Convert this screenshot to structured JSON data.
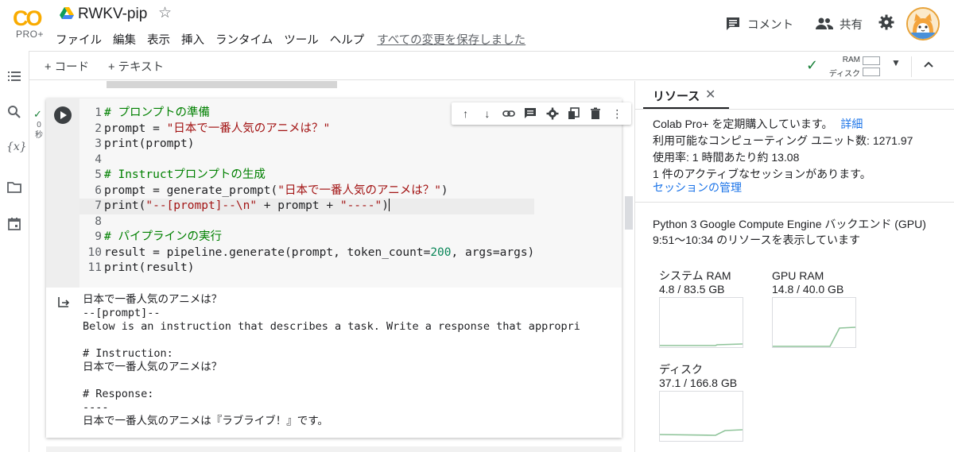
{
  "header": {
    "logo_text": "CO",
    "logo_badge": "PRO+",
    "title": "RWKV-pip",
    "menu": [
      "ファイル",
      "編集",
      "表示",
      "挿入",
      "ランタイム",
      "ツール",
      "ヘルプ"
    ],
    "save_status": "すべての変更を保存しました",
    "comment_label": "コメント",
    "share_label": "共有"
  },
  "toolbar": {
    "add_code": "+ コード",
    "add_text": "+ テキスト",
    "ram_label": "RAM",
    "disk_label": "ディスク"
  },
  "cell": {
    "exec_time_value": "0",
    "exec_time_unit": "秒",
    "lines": [
      {
        "n": "1",
        "parts": [
          {
            "t": "# プロンプトの準備",
            "c": "com"
          }
        ]
      },
      {
        "n": "2",
        "parts": [
          {
            "t": "prompt = ",
            "c": "fn"
          },
          {
            "t": "\"日本で一番人気のアニメは？\"",
            "c": "str"
          }
        ]
      },
      {
        "n": "3",
        "parts": [
          {
            "t": "print(prompt)",
            "c": "fn"
          }
        ]
      },
      {
        "n": "4",
        "parts": []
      },
      {
        "n": "5",
        "parts": [
          {
            "t": "# Instructプロンプトの生成",
            "c": "com"
          }
        ]
      },
      {
        "n": "6",
        "parts": [
          {
            "t": "prompt = generate_prompt(",
            "c": "fn"
          },
          {
            "t": "\"日本で一番人気のアニメは？\"",
            "c": "str"
          },
          {
            "t": ")",
            "c": "fn"
          }
        ]
      },
      {
        "n": "7",
        "parts": [
          {
            "t": "print(",
            "c": "fn"
          },
          {
            "t": "\"--[prompt]--\\n\"",
            "c": "str"
          },
          {
            "t": " + prompt + ",
            "c": "fn"
          },
          {
            "t": "\"----\"",
            "c": "str"
          },
          {
            "t": ")",
            "c": "fn"
          }
        ]
      },
      {
        "n": "8",
        "parts": []
      },
      {
        "n": "9",
        "parts": [
          {
            "t": "# パイプラインの実行",
            "c": "com"
          }
        ]
      },
      {
        "n": "10",
        "parts": [
          {
            "t": "result = pipeline.generate(prompt, token_count=",
            "c": "fn"
          },
          {
            "t": "200",
            "c": "num"
          },
          {
            "t": ", args=args)",
            "c": "fn"
          }
        ]
      },
      {
        "n": "11",
        "parts": [
          {
            "t": "print(result)",
            "c": "fn"
          }
        ]
      }
    ],
    "output": "日本で一番人気のアニメは？\n--[prompt]--\nBelow is an instruction that describes a task. Write a response that appropri\n\n# Instruction:\n日本で一番人気のアニメは？\n\n# Response:\n----\n日本で一番人気のアニメは『ラブライブ！』です。"
  },
  "resources": {
    "tab_label": "リソース",
    "subscription": "Colab Pro+ を定期購入しています。",
    "details_link": "詳細",
    "compute_units": "利用可能なコンピューティング ユニット数: 1271.97",
    "usage_rate": "使用率: 1 時間あたり約 13.08",
    "active_sessions": "1 件のアクティブなセッションがあります。",
    "manage_sessions": "セッションの管理",
    "backend": "Python 3 Google Compute Engine バックエンド (GPU)",
    "time_range": "9:51〜10:34 のリソースを表示しています",
    "gauges": [
      {
        "name": "システム RAM",
        "value": "4.8 / 83.5 GB",
        "used": 4.8,
        "total": 83.5
      },
      {
        "name": "GPU RAM",
        "value": "14.8 / 40.0 GB",
        "used": 14.8,
        "total": 40.0
      },
      {
        "name": "ディスク",
        "value": "37.1 / 166.8 GB",
        "used": 37.1,
        "total": 166.8
      }
    ]
  },
  "colors": {
    "accent_link": "#1a73e8",
    "graph_line": "#8fc49a",
    "check_green": "#188038"
  }
}
